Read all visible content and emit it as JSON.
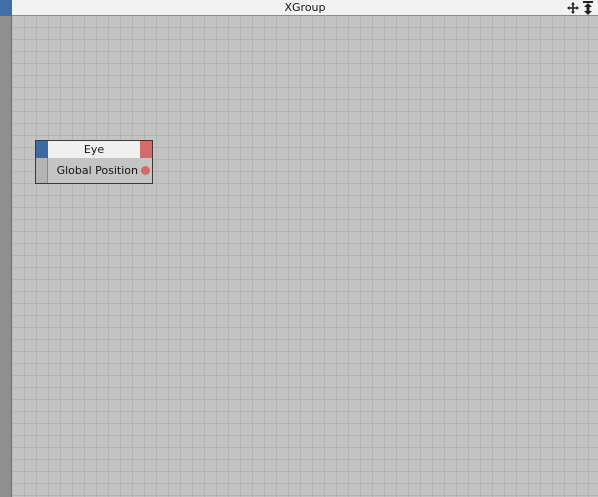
{
  "window": {
    "title": "XGroup"
  },
  "titlebar_icons": [
    {
      "name": "move-icon",
      "glyph": "✥"
    },
    {
      "name": "expand-arrow-icon",
      "glyph": "⇕"
    }
  ],
  "node": {
    "title": "Eye",
    "ports": [
      {
        "label": "Global Position",
        "direction": "output"
      }
    ]
  },
  "colors": {
    "input_port": "#3e6aa3",
    "output_port": "#d46a6a"
  }
}
